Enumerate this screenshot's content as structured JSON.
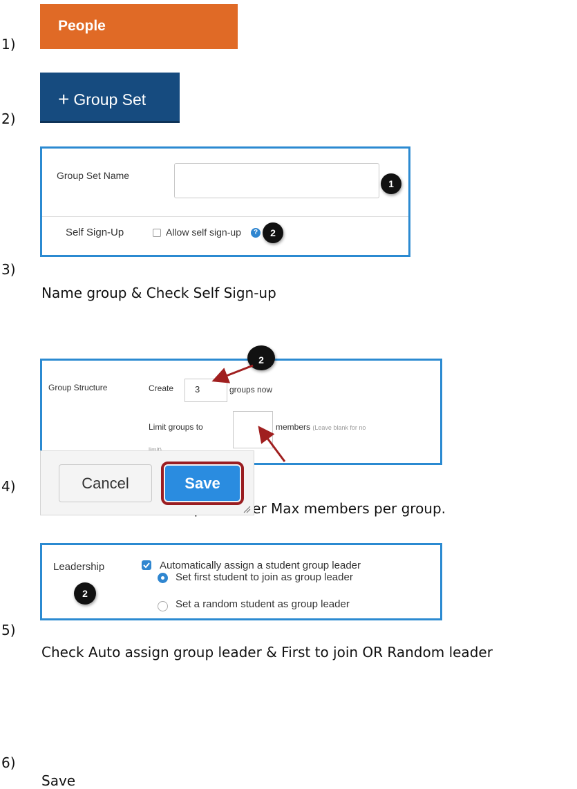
{
  "steps": [
    {
      "number": "1)"
    },
    {
      "number": "2)"
    },
    {
      "number": "3)",
      "caption": "Name group & Check Self Sign-up"
    },
    {
      "number": "4)",
      "caption": "Enter Number of Groups & Enter Max members per group."
    },
    {
      "number": "5)",
      "caption": "Check Auto assign group leader & First to join OR Random leader"
    },
    {
      "number": "6)",
      "caption": "Save"
    }
  ],
  "people_button": {
    "label": "People",
    "color": "#e06a26"
  },
  "group_set_button": {
    "plus": "+",
    "label": "Group Set",
    "color": "#164b7f"
  },
  "group_set_form": {
    "name_label": "Group Set Name",
    "name_value": "",
    "badge1": "1",
    "self_signup_label": "Self Sign-Up",
    "self_signup_checkbox_label": "Allow self sign-up",
    "self_signup_checked": false,
    "help_icon": "?",
    "badge2": "2"
  },
  "group_structure": {
    "label": "Group Structure",
    "create_label": "Create",
    "create_value": "3",
    "groups_now_label": "groups now",
    "limit_label": "Limit groups to",
    "limit_value": "",
    "members_label": "members",
    "hint": "(Leave blank for no",
    "hint_cont": "limit)",
    "badge": "2"
  },
  "leadership": {
    "label": "Leadership",
    "auto_assign_label": "Automatically assign a student group leader",
    "auto_assign_checked": true,
    "option_first": "Set first student to join as group leader",
    "option_random": "Set a random student as group leader",
    "selected": "first",
    "badge": "2"
  },
  "actions": {
    "cancel_label": "Cancel",
    "save_label": "Save",
    "highlight_color": "#9a1d21",
    "save_color": "#2a8ce0"
  },
  "colors": {
    "panel_border": "#2b8ad1",
    "arrow": "#a01f1f"
  }
}
